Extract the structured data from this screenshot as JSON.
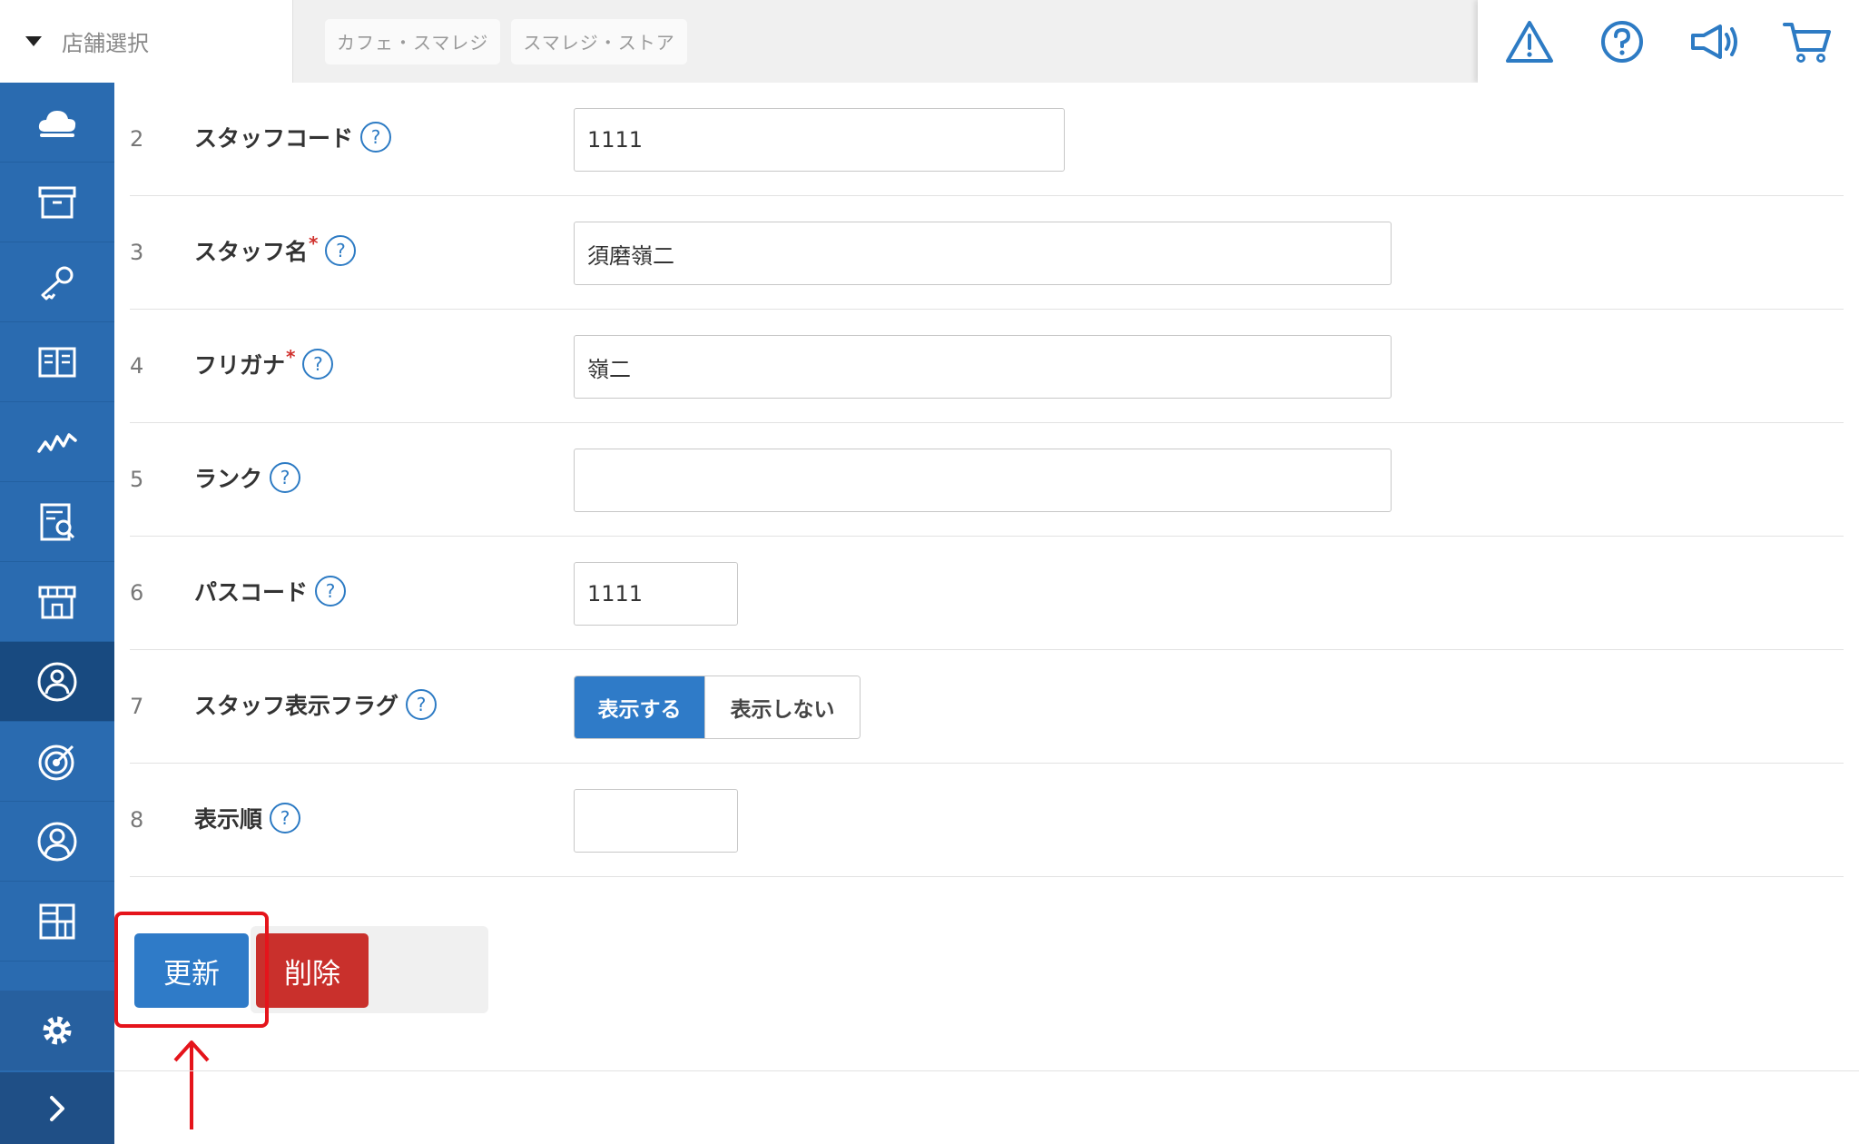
{
  "topbar": {
    "store_select_label": "店舗選択",
    "store_tabs": [
      "カフェ・スマレジ",
      "スマレジ・ストア"
    ],
    "icons": [
      "warning-icon",
      "help-circle-icon",
      "megaphone-icon",
      "cart-icon"
    ]
  },
  "sidebar": {
    "items": [
      "cloud-icon",
      "box-icon",
      "key-icon",
      "book-icon",
      "chart-icon",
      "report-icon",
      "store-icon",
      "staff-icon",
      "target-icon",
      "user-icon",
      "grid-icon",
      "clipboard-icon"
    ],
    "active_item": "staff-icon",
    "bottom": [
      "gear-icon",
      "chevron-right-icon"
    ]
  },
  "form": {
    "rows": [
      {
        "num": "2",
        "label": "スタッフコード",
        "required": false,
        "value": "1111"
      },
      {
        "num": "3",
        "label": "スタッフ名",
        "required": true,
        "value": "須磨嶺二"
      },
      {
        "num": "4",
        "label": "フリガナ",
        "required": true,
        "value": "嶺二"
      },
      {
        "num": "5",
        "label": "ランク",
        "required": false,
        "value": ""
      },
      {
        "num": "6",
        "label": "パスコード",
        "required": false,
        "value": "1111"
      },
      {
        "num": "7",
        "label": "スタッフ表示フラグ",
        "required": false,
        "value": ""
      },
      {
        "num": "8",
        "label": "表示順",
        "required": false,
        "value": ""
      }
    ],
    "required_mark": "*",
    "help_mark": "?",
    "toggle": {
      "on_label": "表示する",
      "off_label": "表示しない",
      "selected": "表示する"
    }
  },
  "actions": {
    "update_label": "更新",
    "delete_label": "削除"
  },
  "colors": {
    "sidebar": "#2a6bb0",
    "primary": "#2f7bc8",
    "danger": "#c9302c",
    "highlight": "#e5141b"
  }
}
